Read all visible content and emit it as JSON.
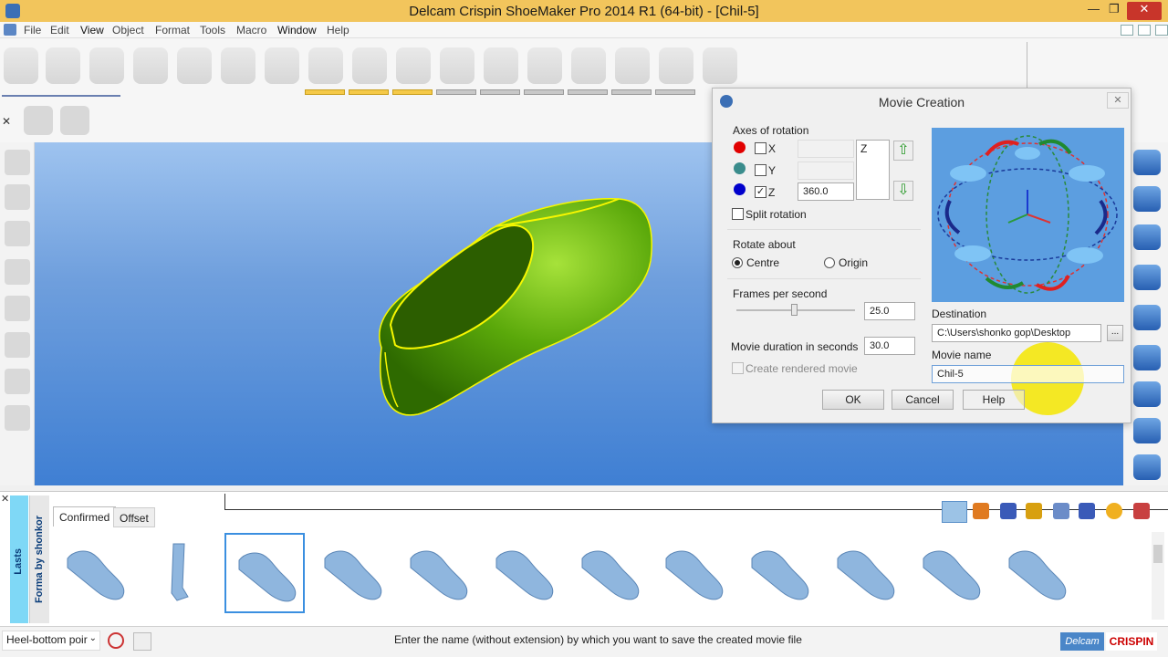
{
  "window": {
    "title": "Delcam Crispin ShoeMaker Pro 2014 R1 (64-bit) - [Chil-5]",
    "minimize": "—",
    "restore": "❐",
    "close": "✕"
  },
  "menu": [
    "File",
    "Edit",
    "View",
    "Object",
    "Format",
    "Tools",
    "Macro",
    "Window",
    "Help"
  ],
  "dialog": {
    "title": "Movie Creation",
    "axes_label": "Axes of rotation",
    "axes": [
      {
        "name": "X",
        "checked": false,
        "value": "",
        "color": "#e10000"
      },
      {
        "name": "Y",
        "checked": false,
        "value": "",
        "color": "#3a8c8c"
      },
      {
        "name": "Z",
        "checked": true,
        "value": "360.0",
        "color": "#0000cc"
      }
    ],
    "axis_list": [
      "Z"
    ],
    "split_rotation": "Split rotation",
    "rotate_about_label": "Rotate about",
    "rotate_options": [
      "Centre",
      "Origin"
    ],
    "rotate_selected": "Centre",
    "fps_label": "Frames per second",
    "fps": "25.0",
    "fps_slider_fraction": 0.33,
    "duration_label": "Movie duration in seconds",
    "duration": "30.0",
    "rendered_label": "Create rendered movie",
    "destination_label": "Destination",
    "destination": "C:\\Users\\shonko gop\\Desktop",
    "browse": "...",
    "movie_name_label": "Movie name",
    "movie_name": "Chil-5",
    "ok": "OK",
    "cancel": "Cancel",
    "help": "Help"
  },
  "bottom": {
    "side_tabs": [
      "Lasts",
      "Forma by shonkor"
    ],
    "tabs": [
      "Confirmed",
      "Offset"
    ],
    "active_tab": "Confirmed",
    "thumbnail_count": 12,
    "selected_index": 2
  },
  "status": {
    "dropdown": "Heel-bottom poir",
    "message": "Enter the name (without extension) by which you want to save the created movie file",
    "logo_delcam": "Delcam",
    "logo_crispin": "CRISPIN"
  },
  "colors": {
    "title_bar": "#f2c55c",
    "viewport_top": "#9ec3ef",
    "viewport_bottom": "#3f7fd3",
    "shoe_green": "#5aa80a",
    "outline_yellow": "#f7f700",
    "highlight": "#f5e600"
  }
}
